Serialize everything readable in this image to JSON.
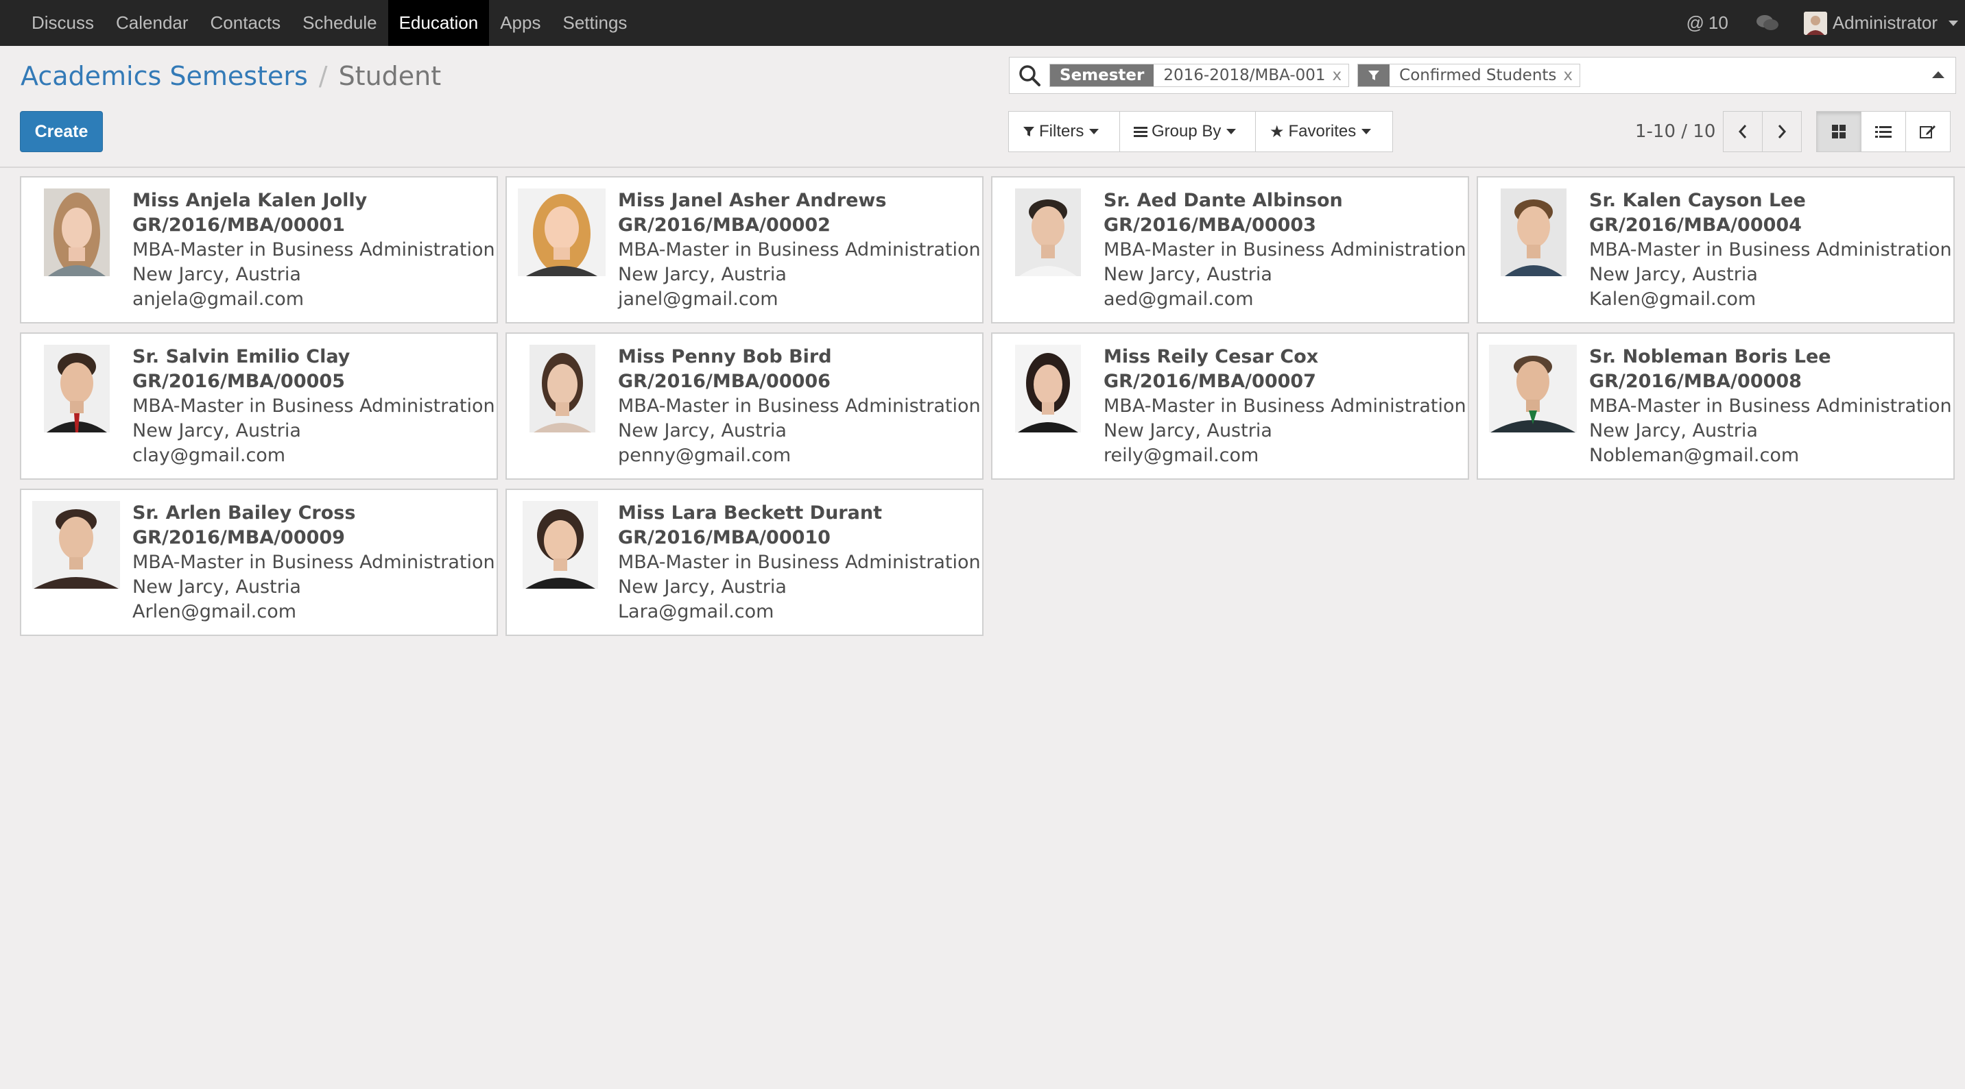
{
  "nav": {
    "items": [
      "Discuss",
      "Calendar",
      "Contacts",
      "Schedule",
      "Education",
      "Apps",
      "Settings"
    ],
    "active": "Education",
    "mentions_count": "10",
    "user_name": "Administrator"
  },
  "breadcrumb": {
    "parent": "Academics Semesters",
    "separator": "/",
    "current": "Student"
  },
  "toolbar": {
    "create_label": "Create",
    "filters_label": "Filters",
    "groupby_label": "Group By",
    "favorites_label": "Favorites"
  },
  "search": {
    "facets": [
      {
        "label": "Semester",
        "value": "2016-2018/MBA-001"
      },
      {
        "label": "filter-icon",
        "value": "Confirmed Students"
      }
    ],
    "remove_glyph": "x"
  },
  "pager": {
    "value": "1-10 / 10"
  },
  "students": [
    {
      "name": "Miss Anjela Kalen Jolly",
      "code": "GR/2016/MBA/00001",
      "program": "MBA-Master in Business Administration",
      "location": "New Jarcy, Austria",
      "email": "anjela@gmail.com"
    },
    {
      "name": "Miss Janel Asher Andrews",
      "code": "GR/2016/MBA/00002",
      "program": "MBA-Master in Business Administration",
      "location": "New Jarcy, Austria",
      "email": "janel@gmail.com"
    },
    {
      "name": "Sr. Aed Dante Albinson",
      "code": "GR/2016/MBA/00003",
      "program": "MBA-Master in Business Administration",
      "location": "New Jarcy, Austria",
      "email": "aed@gmail.com"
    },
    {
      "name": "Sr. Kalen Cayson Lee",
      "code": "GR/2016/MBA/00004",
      "program": "MBA-Master in Business Administration",
      "location": "New Jarcy, Austria",
      "email": "Kalen@gmail.com"
    },
    {
      "name": "Sr. Salvin Emilio Clay",
      "code": "GR/2016/MBA/00005",
      "program": "MBA-Master in Business Administration",
      "location": "New Jarcy, Austria",
      "email": "clay@gmail.com"
    },
    {
      "name": "Miss Penny Bob Bird",
      "code": "GR/2016/MBA/00006",
      "program": "MBA-Master in Business Administration",
      "location": "New Jarcy, Austria",
      "email": "penny@gmail.com"
    },
    {
      "name": "Miss Reily Cesar Cox",
      "code": "GR/2016/MBA/00007",
      "program": "MBA-Master in Business Administration",
      "location": "New Jarcy, Austria",
      "email": "reily@gmail.com"
    },
    {
      "name": "Sr. Nobleman Boris Lee",
      "code": "GR/2016/MBA/00008",
      "program": "MBA-Master in Business Administration",
      "location": "New Jarcy, Austria",
      "email": "Nobleman@gmail.com"
    },
    {
      "name": "Sr. Arlen Bailey Cross",
      "code": "GR/2016/MBA/00009",
      "program": "MBA-Master in Business Administration",
      "location": "New Jarcy, Austria",
      "email": "Arlen@gmail.com"
    },
    {
      "name": "Miss Lara Beckett Durant",
      "code": "GR/2016/MBA/00010",
      "program": "MBA-Master in Business Administration",
      "location": "New Jarcy, Austria",
      "email": "Lara@gmail.com"
    }
  ],
  "colors": {
    "navbar_bg": "#262626",
    "accent_link": "#337ab7",
    "primary_button": "#2d7db8",
    "page_bg": "#f0eeee"
  }
}
